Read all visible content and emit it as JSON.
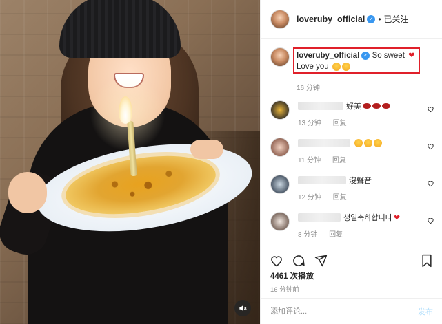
{
  "colors": {
    "accent": "#3897f0",
    "highlight_box": "#e0202a",
    "muted_text": "#8e8e8e",
    "post_button_disabled": "#b2dffc",
    "heart_red": "#e0202a"
  },
  "media": {
    "mute_icon": "speaker-muted-icon"
  },
  "header": {
    "username": "loveruby_official",
    "verified_icon": "verified-badge-icon",
    "separator": "•",
    "follow_status": "已关注"
  },
  "caption": {
    "username": "loveruby_official",
    "text_line1": "So sweet",
    "text_line2": "Love you",
    "time": "16 分钟"
  },
  "comments": [
    {
      "text": "好美",
      "time": "13 分钟",
      "reply": "回复",
      "emoji": "lips-icon"
    },
    {
      "text": "",
      "time": "11 分钟",
      "reply": "回复",
      "emoji": "smiling-face-icon"
    },
    {
      "text": "沒聲音",
      "time": "12 分钟",
      "reply": "回复",
      "emoji": ""
    },
    {
      "text": "생일축하합니다",
      "time": "8 分钟",
      "reply": "回复",
      "emoji": "red-heart-icon"
    }
  ],
  "actions": {
    "like_icon": "heart-outline-icon",
    "comment_icon": "comment-bubble-icon",
    "share_icon": "paper-plane-icon",
    "save_icon": "bookmark-icon",
    "plays": "4461 次播放",
    "post_time": "16 分钟前"
  },
  "composer": {
    "placeholder": "添加评论...",
    "post_label": "发布"
  }
}
